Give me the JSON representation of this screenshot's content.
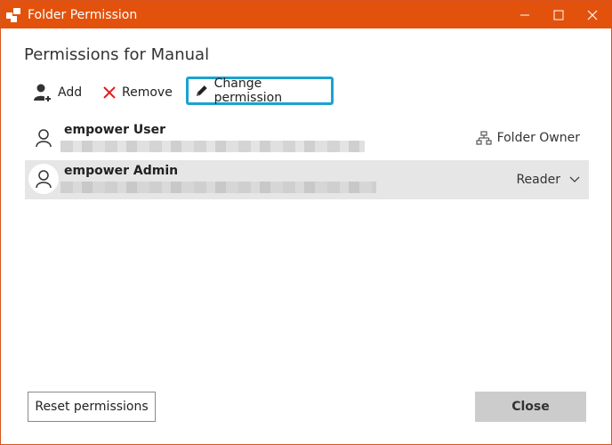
{
  "window": {
    "title": "Folder Permission",
    "accent_color": "#e2520d"
  },
  "heading": "Permissions for Manual",
  "toolbar": {
    "add_label": "Add",
    "remove_label": "Remove",
    "change_permission_label": "Change permission"
  },
  "users": [
    {
      "name": "empower User",
      "role": "Folder Owner",
      "selected": false
    },
    {
      "name": "empower Admin",
      "role": "Reader",
      "selected": true
    }
  ],
  "buttons": {
    "reset_label": "Reset permissions",
    "close_label": "Close"
  },
  "icons": {
    "app": "folder-permission-app-icon",
    "add": "add-user-icon",
    "remove": "red-x-icon",
    "change": "pencil-icon",
    "owner": "hierarchy-icon",
    "avatar": "person-icon",
    "dropdown": "chevron-down-icon"
  }
}
